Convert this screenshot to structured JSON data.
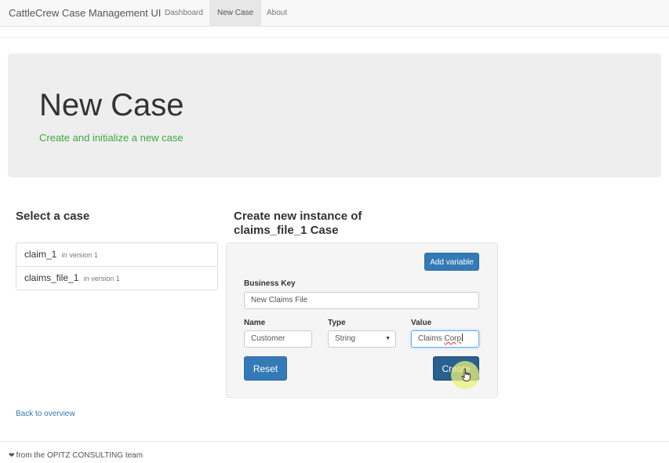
{
  "navbar": {
    "brand": "CattleCrew Case Management UI",
    "items": [
      {
        "label": "Dashboard",
        "active": false
      },
      {
        "label": "New Case",
        "active": true
      },
      {
        "label": "About",
        "active": false
      }
    ]
  },
  "jumbotron": {
    "title": "New Case",
    "subtitle": "Create and initialize a new case"
  },
  "case_select": {
    "heading": "Select a case",
    "cases": [
      {
        "name": "claim_1",
        "version": "in version 1"
      },
      {
        "name": "claims_file_1",
        "version": "in version 1"
      }
    ]
  },
  "create_form": {
    "heading": "Create new instance of claims_file_1 Case",
    "add_variable_label": "Add variable",
    "business_key_label": "Business Key",
    "business_key_value": "New Claims File",
    "name_label": "Name",
    "type_label": "Type",
    "value_label": "Value",
    "variable": {
      "name": "Customer",
      "type": "String",
      "value_prefix": "Claims ",
      "value_word": "Corp"
    },
    "reset_label": "Reset",
    "create_label": "Create"
  },
  "back_link": "Back to overview",
  "footer": {
    "icon": "heart-icon",
    "text": "from the OPITZ CONSULTING team"
  },
  "colors": {
    "primary": "#337ab7",
    "primary_active": "#286090",
    "subtitle_green": "#3fa83f"
  }
}
